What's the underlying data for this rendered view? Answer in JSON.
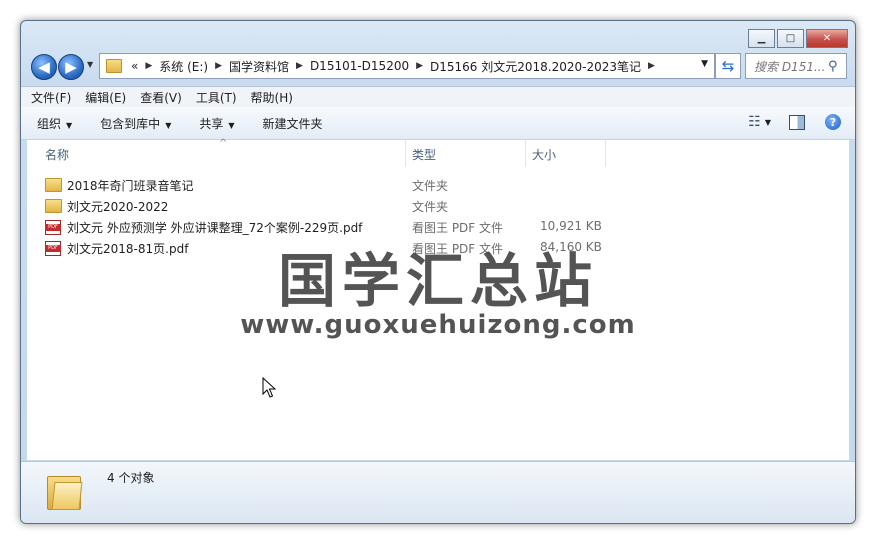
{
  "window": {
    "buttons": {
      "minimize": "▁",
      "maximize": "□",
      "close": "✕"
    }
  },
  "nav": {
    "back_glyph": "◀",
    "forward_glyph": "▶",
    "overflow": "«",
    "breadcrumbs": [
      "系统 (E:)",
      "国学资料馆",
      "D15101-D15200",
      "D15166 刘文元2018.2020-2023笔记"
    ],
    "search_placeholder": "搜索 D151..."
  },
  "menu": {
    "items": [
      "文件(F)",
      "编辑(E)",
      "查看(V)",
      "工具(T)",
      "帮助(H)"
    ]
  },
  "toolbar": {
    "organize": "组织",
    "include_in_library": "包含到库中",
    "share": "共享",
    "new_folder": "新建文件夹",
    "help": "?"
  },
  "columns": {
    "name": "名称",
    "type": "类型",
    "size": "大小"
  },
  "files": [
    {
      "name": "2018年奇门班录音笔记",
      "type": "文件夹",
      "size": "",
      "icon": "folder-icon"
    },
    {
      "name": "刘文元2020-2022",
      "type": "文件夹",
      "size": "",
      "icon": "folder-icon"
    },
    {
      "name": "刘文元 外应预测学 外应讲课整理_72个案例-229页.pdf",
      "type": "看图王 PDF 文件",
      "size": "10,921 KB",
      "icon": "pdf-icon"
    },
    {
      "name": "刘文元2018-81页.pdf",
      "type": "看图王 PDF 文件",
      "size": "84,160 KB",
      "icon": "pdf-icon"
    }
  ],
  "watermark": {
    "title": "国学汇总站",
    "url": "www.guoxuehuizong.com"
  },
  "details": {
    "count": "4 个对象"
  },
  "colors": {
    "accent": "#2b6cc4",
    "chrome": "#c9dcef"
  }
}
